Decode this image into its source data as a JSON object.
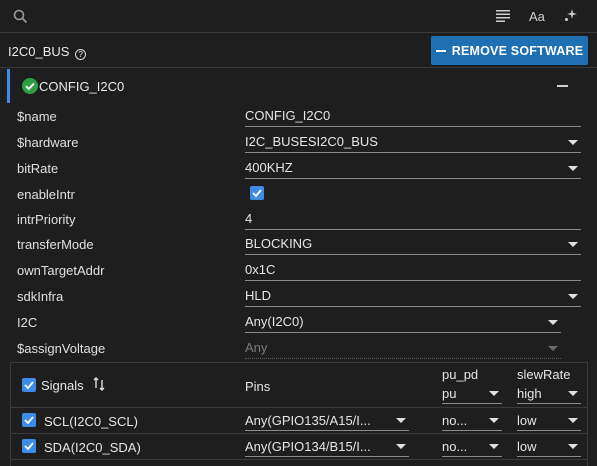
{
  "toolbar": {
    "search_icon": "search-icon",
    "list_icon": "list-icon",
    "font_label": "Aa",
    "star_icon": "sparkle-icon"
  },
  "module": {
    "title": "I2C0_BUS",
    "help_icon": "?",
    "remove_label": "REMOVE SOFTWARE"
  },
  "config": {
    "title": "CONFIG_I2C0",
    "status_color": "#2ea043",
    "accent_color": "#3d8be6"
  },
  "params": [
    {
      "label": "$name",
      "value": "CONFIG_I2C0"
    },
    {
      "label": "$hardware",
      "value": "I2C_BUSESI2C0_BUS"
    },
    {
      "label": "bitRate",
      "value": "400KHZ"
    },
    {
      "label": "enableIntr",
      "checked": true
    },
    {
      "label": "intrPriority",
      "value": "4"
    },
    {
      "label": "transferMode",
      "value": "BLOCKING"
    },
    {
      "label": "ownTargetAddr",
      "value": "0x1C"
    },
    {
      "label": "sdkInfra",
      "value": "HLD"
    },
    {
      "label": "I2C",
      "value": "Any(I2C0)"
    },
    {
      "label": "$assignVoltage",
      "value": "Any"
    }
  ],
  "signals": {
    "header": {
      "signals_label": "Signals",
      "sort_icon": "sort-icon",
      "pins_label": "Pins",
      "pupd_label": "pu_pd",
      "pupd_value": "pu",
      "slew_label": "slewRate",
      "slew_value": "high"
    },
    "rows": [
      {
        "name": "SCL(I2C0_SCL)",
        "pin": "Any(GPIO135/A15/I...",
        "pupd": "no...",
        "slew": "low"
      },
      {
        "name": "SDA(I2C0_SDA)",
        "pin": "Any(GPIO134/B15/I...",
        "pupd": "no...",
        "slew": "low"
      }
    ]
  }
}
